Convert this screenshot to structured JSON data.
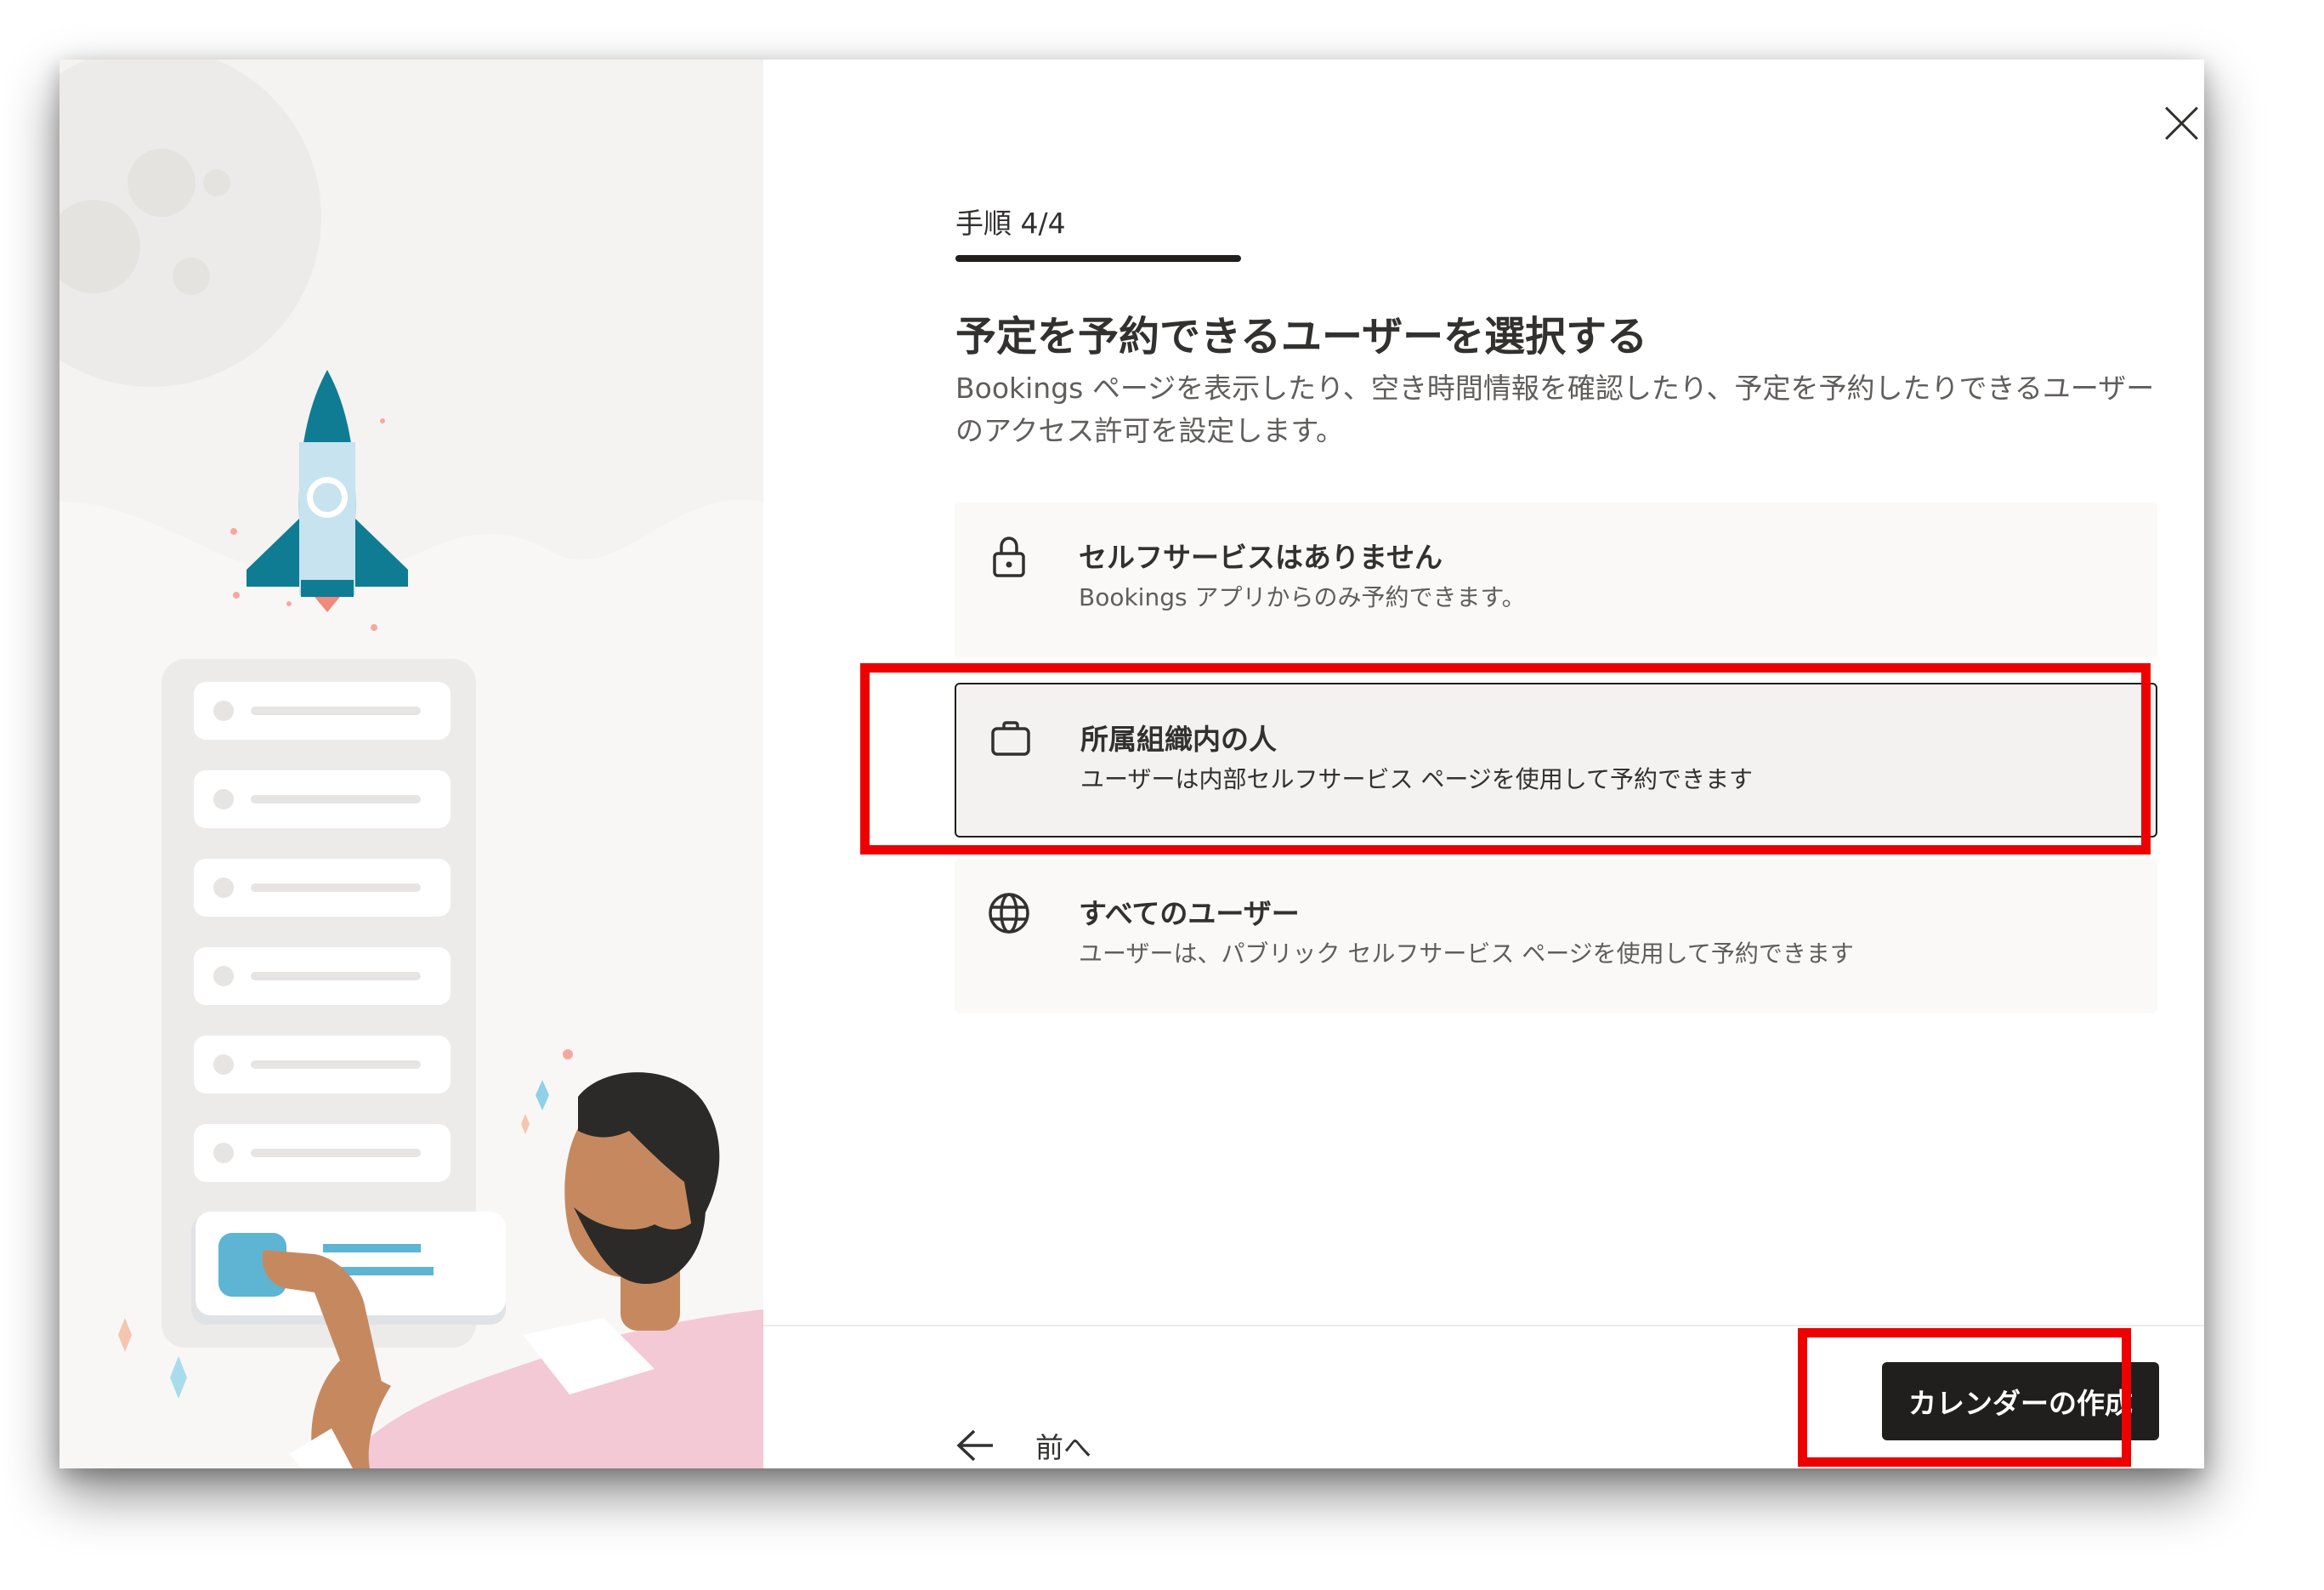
{
  "dialog": {
    "step_label": "手順 4/4",
    "title": "予定を予約できるユーザーを選択する",
    "description": "Bookings ページを表示したり、空き時間情報を確認したり、予定を予約したりできるユーザーのアクセス許可を設定します。",
    "options": [
      {
        "icon": "lock-icon",
        "title": "セルフサービスはありません",
        "description": "Bookings アプリからのみ予約できます。",
        "selected": false
      },
      {
        "icon": "briefcase-icon",
        "title": "所属組織内の人",
        "description": "ユーザーは内部セルフサービス ページを使用して予約できます",
        "selected": true
      },
      {
        "icon": "globe-icon",
        "title": "すべてのユーザー",
        "description": "ユーザーは、パブリック セルフサービス ページを使用して予約できます",
        "selected": false
      }
    ]
  },
  "footer": {
    "back_label": "前へ",
    "create_label": "カレンダーの作成"
  },
  "colors": {
    "primary_button": "#201f1e",
    "highlight_annotation": "#ee0000",
    "illustration_bg": "#f4f3f1",
    "accent_teal": "#0f7c94"
  }
}
